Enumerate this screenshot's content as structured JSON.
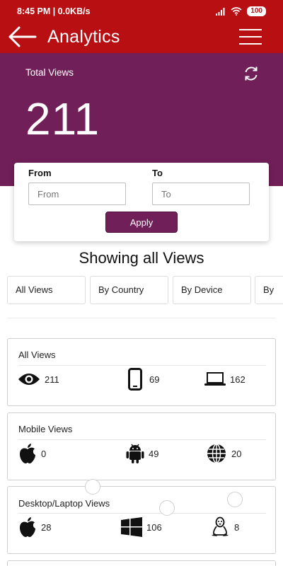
{
  "status_bar": {
    "time": "8:45 PM | 0.0KB/s",
    "battery": "100"
  },
  "app_bar": {
    "title": "Analytics",
    "back_icon": "arrow-left-icon",
    "menu_icon": "hamburger-icon"
  },
  "summary": {
    "label": "Total Views",
    "value": "211",
    "refresh_icon": "refresh-icon"
  },
  "date_filter": {
    "from_label": "From",
    "from_placeholder": "From",
    "from_value": "",
    "to_label": "To",
    "to_placeholder": "To",
    "to_value": "",
    "apply_label": "Apply"
  },
  "heading": "Showing all Views",
  "tabs": [
    "All Views",
    "By Country",
    "By Device",
    "By"
  ],
  "cards": [
    {
      "title": "All Views",
      "stats": [
        {
          "icon": "eye-icon",
          "value": "211"
        },
        {
          "icon": "mobile-phone-icon",
          "value": "69"
        },
        {
          "icon": "laptop-icon",
          "value": "162"
        }
      ]
    },
    {
      "title": "Mobile Views",
      "stats": [
        {
          "icon": "apple-icon",
          "value": "0"
        },
        {
          "icon": "android-icon",
          "value": "49"
        },
        {
          "icon": "globe-icon",
          "value": "20"
        }
      ]
    },
    {
      "title": "Desktop/Laptop Views",
      "stats": [
        {
          "icon": "apple-icon",
          "value": "28"
        },
        {
          "icon": "windows-icon",
          "value": "106"
        },
        {
          "icon": "linux-icon",
          "value": "8"
        }
      ]
    }
  ],
  "colors": {
    "primary_red": "#b80f12",
    "accent_purple": "#711f58"
  }
}
